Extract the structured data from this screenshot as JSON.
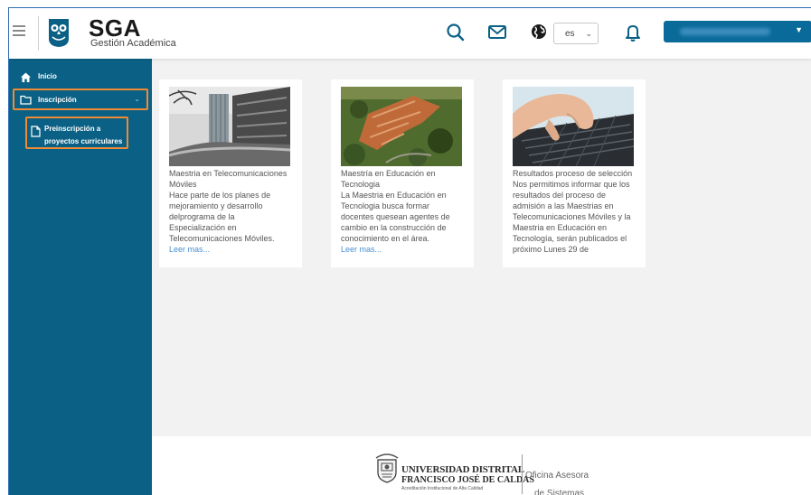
{
  "header": {
    "brand_title": "SGA",
    "brand_subtitle": "Gestión Académica",
    "language_value": "es",
    "icons": [
      "menu-icon",
      "owl-logo-icon",
      "search-icon",
      "mail-icon",
      "globe-icon",
      "bell-icon"
    ],
    "accent_color": "#0a6a9a"
  },
  "sidebar": {
    "items": [
      {
        "label": "Inicio",
        "icon": "home-icon"
      },
      {
        "label": "Inscripción",
        "icon": "folder-icon"
      }
    ],
    "sub_items": [
      {
        "label": "Preinscripción a proyectos curriculares",
        "icon": "document-icon"
      }
    ],
    "background_color": "#0b6185",
    "highlight_color": "#f08a34"
  },
  "cards": [
    {
      "title": "Maestria en Telecomunicaciones Móviles",
      "text": "Hace parte de los planes de mejoramiento y desarrollo delprograma de la Especialización en Telecomunicaciones Móviles.",
      "link": "Leer mas..."
    },
    {
      "title": "Maestría en Educación en Tecnologia",
      "text": "La Maestria en Educación en Tecnologia busca formar docentes quesean agentes de cambio en la construcción de conocimiento en el área.",
      "link": "Leer mas..."
    },
    {
      "title": "Resultados proceso de selección",
      "text": "Nos permitimos informar que los resultados del proceso de admisión a las Maestrias en Telecomunicaciones Móviles y la Maestria en Educación en Tecnología, serán publicados el próximo Lunes 29 de",
      "link": ""
    }
  ],
  "footer": {
    "university_line1": "UNIVERSIDAD DISTRITAL",
    "university_line2": "FRANCISCO JOSÉ DE CALDAS",
    "accreditation": "Acreditación Institucional de Alta Calidad",
    "office_line1": "Oficina Asesora",
    "office_line2": "de Sistemas"
  }
}
